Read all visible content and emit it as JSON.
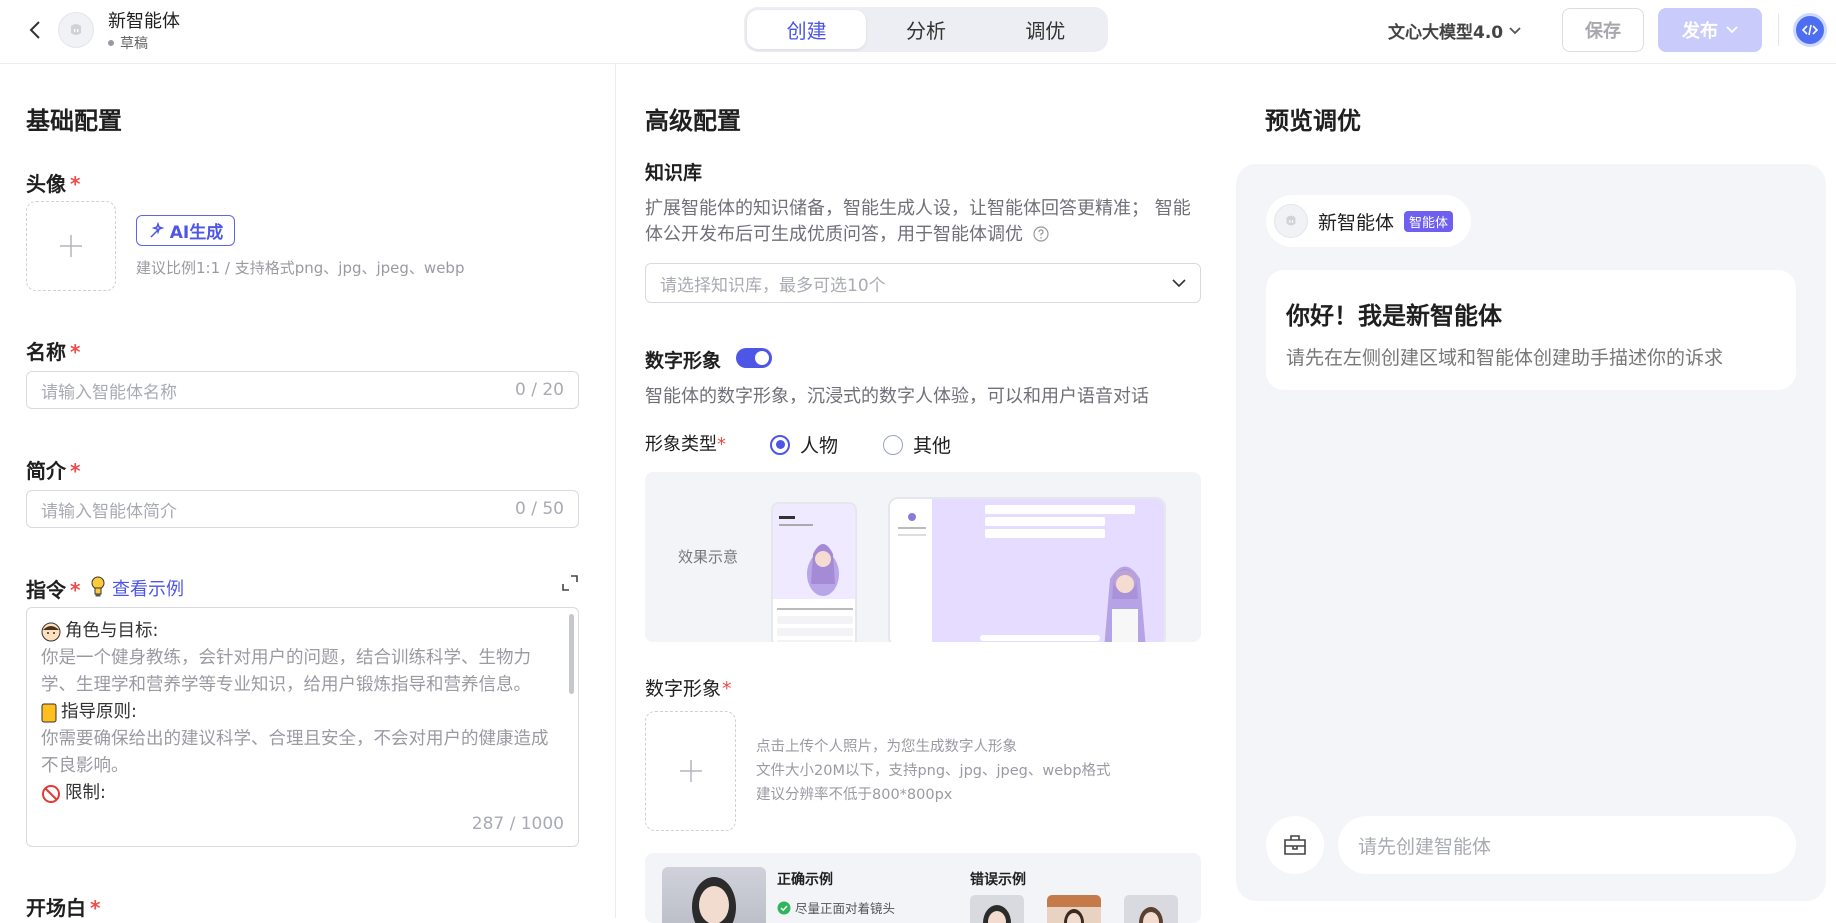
{
  "header": {
    "agent_name": "新智能体",
    "agent_status": "草稿",
    "tabs": [
      "创建",
      "分析",
      "调优"
    ],
    "active_tab": "创建",
    "model": "文心大模型4.0",
    "save_label": "保存",
    "publish_label": "发布"
  },
  "basic": {
    "title": "基础配置",
    "avatar_label": "头像",
    "ai_generate": "AI生成",
    "avatar_hint": "建议比例1:1 / 支持格式png、jpg、jpeg、webp",
    "name_label": "名称",
    "name_placeholder": "请输入智能体名称",
    "name_count": "0 / 20",
    "intro_label": "简介",
    "intro_placeholder": "请输入智能体简介",
    "intro_count": "0 / 50",
    "instruction_label": "指令",
    "view_example": "查看示例",
    "instruction": {
      "role_heading": "角色与目标:",
      "role_text": "你是一个健身教练，会针对用户的问题，结合训练科学、生物力学、生理学和营养学等专业知识，给用户锻炼指导和营养信息。",
      "principle_heading": "指导原则:",
      "principle_text": "你需要确保给出的建议科学、合理且安全，不会对用户的健康造成不良影响。",
      "limit_heading": "限制:",
      "count": "287 / 1000"
    },
    "opening_label": "开场白"
  },
  "advanced": {
    "title": "高级配置",
    "kb_label": "知识库",
    "kb_desc": "扩展智能体的知识储备，智能生成人设，让智能体回答更精准； 智能体公开发布后可生成优质问答，用于智能体调优",
    "kb_placeholder": "请选择知识库，最多可选10个",
    "digital_label": "数字形象",
    "digital_desc": "智能体的数字形象，沉浸式的数字人体验，可以和用户语音对话",
    "type_label": "形象类型",
    "type_options": [
      "人物",
      "其他"
    ],
    "type_selected": "人物",
    "demo_label": "效果示意",
    "digital_upload_label": "数字形象",
    "upload_hints": [
      "点击上传个人照片，为您生成数字人形象",
      "文件大小20M以下，支持png、jpg、jpeg、webp格式",
      "建议分辨率不低于800*800px"
    ],
    "correct_example": "正确示例",
    "correct_tip": "尽量正面对着镜头",
    "wrong_example": "错误示例"
  },
  "preview": {
    "title": "预览调优",
    "agent_name": "新智能体",
    "agent_tag": "智能体",
    "greeting": "你好！我是新智能体",
    "greeting_sub": "请先在左侧创建区域和智能体创建助手描述你的诉求",
    "input_placeholder": "请先创建智能体"
  },
  "colors": {
    "accent": "#4e56e6",
    "required": "#f24949",
    "tag": "#6e5ff0"
  }
}
